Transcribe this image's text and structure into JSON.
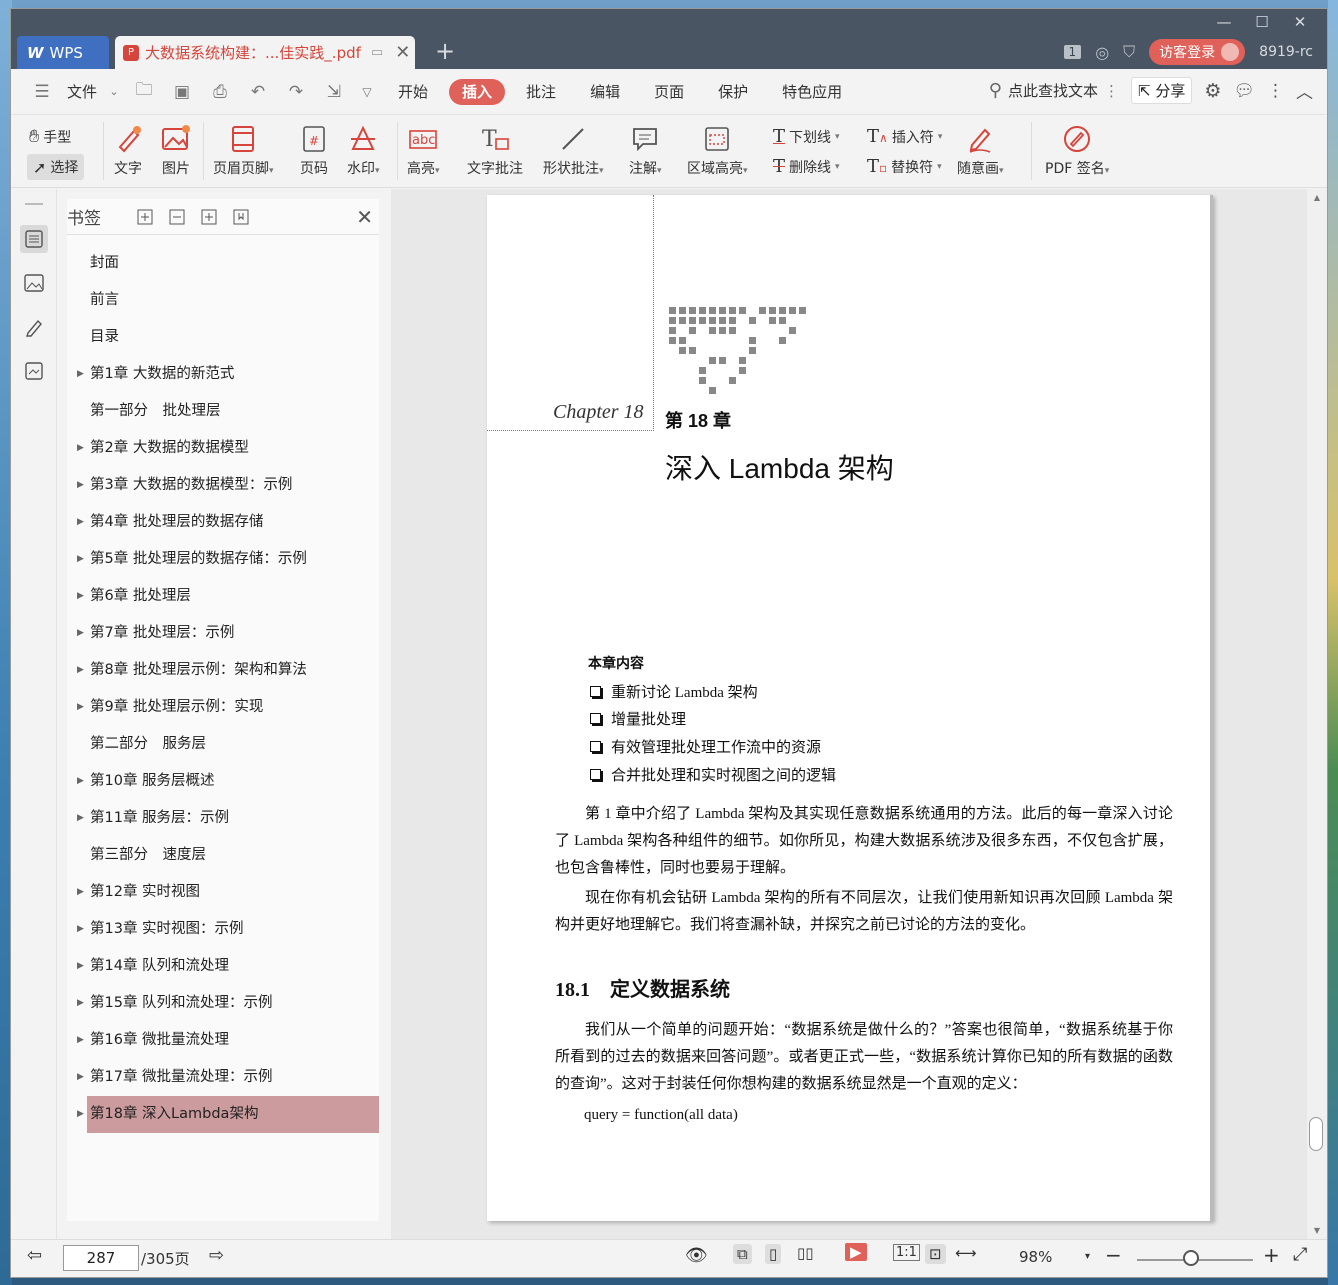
{
  "titlebar": {
    "app_tab": "WPS",
    "doc_tab": "大数据系统构建：...佳实践_.pdf",
    "page_count_badge": "1",
    "login_label": "访客登录",
    "user_name": "8919-rc"
  },
  "menu": {
    "file_label": "文件",
    "tabs": [
      "开始",
      "插入",
      "批注",
      "编辑",
      "页面",
      "保护",
      "特色应用"
    ],
    "active_tab": "插入",
    "search_label": "点此查找文本",
    "share_label": "分享"
  },
  "ribbon": {
    "hand": "手型",
    "select": "选择",
    "text": "文字",
    "image": "图片",
    "header_footer": "页眉页脚",
    "page_num": "页码",
    "watermark": "水印",
    "highlight": "高亮",
    "text_comment": "文字批注",
    "shape_comment": "形状批注",
    "note": "注解",
    "area_highlight": "区域高亮",
    "underline": "下划线",
    "strikethrough": "删除线",
    "insert_mark": "插入符",
    "replace_mark": "替换符",
    "freehand": "随意画",
    "pdf_sign": "PDF 签名"
  },
  "bookmarks": {
    "title": "书签",
    "items": [
      {
        "label": "封面",
        "expandable": false
      },
      {
        "label": "前言",
        "expandable": false
      },
      {
        "label": "目录",
        "expandable": false
      },
      {
        "label": "第1章 大数据的新范式",
        "expandable": true
      },
      {
        "label": "第一部分　批处理层",
        "expandable": false
      },
      {
        "label": "第2章 大数据的数据模型",
        "expandable": true
      },
      {
        "label": "第3章 大数据的数据模型：示例",
        "expandable": true
      },
      {
        "label": "第4章 批处理层的数据存储",
        "expandable": true
      },
      {
        "label": "第5章 批处理层的数据存储：示例",
        "expandable": true
      },
      {
        "label": "第6章 批处理层",
        "expandable": true
      },
      {
        "label": "第7章 批处理层：示例",
        "expandable": true
      },
      {
        "label": "第8章 批处理层示例：架构和算法",
        "expandable": true
      },
      {
        "label": "第9章 批处理层示例：实现",
        "expandable": true
      },
      {
        "label": "第二部分　服务层",
        "expandable": false
      },
      {
        "label": "第10章 服务层概述",
        "expandable": true
      },
      {
        "label": "第11章 服务层：示例",
        "expandable": true
      },
      {
        "label": "第三部分　速度层",
        "expandable": false
      },
      {
        "label": "第12章 实时视图",
        "expandable": true
      },
      {
        "label": "第13章 实时视图：示例",
        "expandable": true
      },
      {
        "label": "第14章 队列和流处理",
        "expandable": true
      },
      {
        "label": "第15章 队列和流处理：示例",
        "expandable": true
      },
      {
        "label": "第16章 微批量流处理",
        "expandable": true
      },
      {
        "label": "第17章 微批量流处理：示例",
        "expandable": true
      },
      {
        "label": "第18章 深入Lambda架构",
        "expandable": true,
        "selected": true
      }
    ]
  },
  "page": {
    "chapter_script": "Chapter 18",
    "chapter_num": "第 18 章",
    "chapter_title": "深入 Lambda 架构",
    "contents_head": "本章内容",
    "contents": [
      "重新讨论 Lambda 架构",
      "增量批处理",
      "有效管理批处理工作流中的资源",
      "合并批处理和实时视图之间的逻辑"
    ],
    "para1": "第 1 章中介绍了 Lambda 架构及其实现任意数据系统通用的方法。此后的每一章深入讨论了 Lambda 架构各种组件的细节。如你所见，构建大数据系统涉及很多东西，不仅包含扩展，也包含鲁棒性，同时也要易于理解。",
    "para2": "现在你有机会钻研 Lambda 架构的所有不同层次，让我们使用新知识再次回顾 Lambda 架构并更好地理解它。我们将查漏补缺，并探究之前已讨论的方法的变化。",
    "section_head": "18.1　定义数据系统",
    "para3": "我们从一个简单的问题开始：“数据系统是做什么的？”答案也很简单，“数据系统基于你所看到的过去的数据来回答问题”。或者更正式一些，“数据系统计算你已知的所有数据的函数的查询”。这对于封装任何你想构建的数据系统显然是一个直观的定义：",
    "query": "query  =  function(all data)"
  },
  "status": {
    "current_page": "287",
    "total_pages": "/305页",
    "zoom": "98%"
  }
}
